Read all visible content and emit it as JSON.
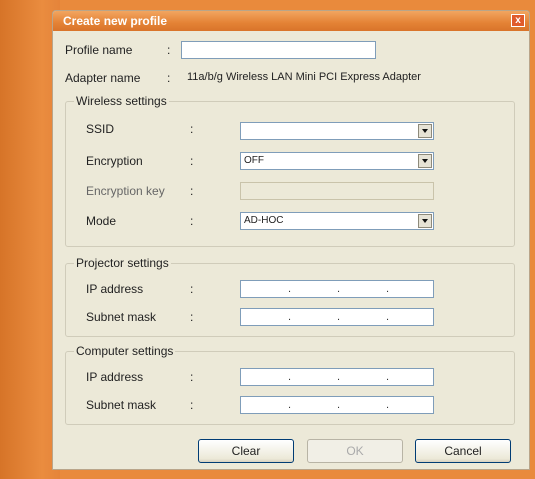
{
  "dialog": {
    "title": "Create new profile",
    "close_symbol": "x"
  },
  "profile": {
    "profile_name_label": "Profile name",
    "profile_name_value": "",
    "adapter_label": "Adapter name",
    "adapter_value": "11a/b/g Wireless LAN Mini PCI Express Adapter"
  },
  "wireless": {
    "group_label": "Wireless settings",
    "ssid_label": "SSID",
    "ssid_value": "",
    "encryption_label": "Encryption",
    "encryption_value": "OFF",
    "encryption_key_label": "Encryption key",
    "mode_label": "Mode",
    "mode_value": "AD-HOC"
  },
  "projector": {
    "group_label": "Projector settings",
    "ip_label": "IP address",
    "subnet_label": "Subnet mask"
  },
  "computer": {
    "group_label": "Computer settings",
    "ip_label": "IP address",
    "subnet_label": "Subnet mask"
  },
  "buttons": {
    "clear": "Clear",
    "ok": "OK",
    "cancel": "Cancel"
  },
  "separators": {
    "colon": ":",
    "dot": "."
  }
}
